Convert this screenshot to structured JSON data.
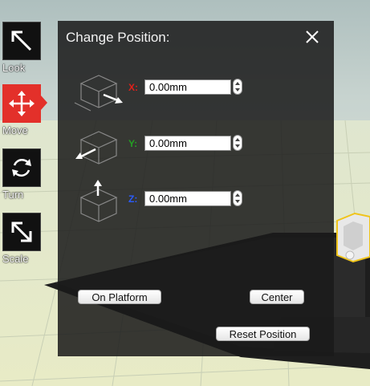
{
  "tools": [
    {
      "label": "Look",
      "icon": "look-arrow-icon",
      "active": false
    },
    {
      "label": "Move",
      "icon": "move-arrows-icon",
      "active": true
    },
    {
      "label": "Turn",
      "icon": "rotate-icon",
      "active": false
    },
    {
      "label": "Scale",
      "icon": "scale-arrow-icon",
      "active": false
    }
  ],
  "panel": {
    "title": "Change Position:",
    "axes": [
      {
        "label": "X:",
        "value": "0.00mm",
        "color": "#e0201a"
      },
      {
        "label": "Y:",
        "value": "0.00mm",
        "color": "#23a023"
      },
      {
        "label": "Z:",
        "value": "0.00mm",
        "color": "#2a5cff"
      }
    ],
    "buttons": {
      "on_platform": "On Platform",
      "center": "Center",
      "reset": "Reset Position"
    }
  },
  "colors": {
    "active_tool": "#e3302a",
    "panel_bg": "#1a1a1a",
    "selection_highlight": "#f0c419"
  }
}
